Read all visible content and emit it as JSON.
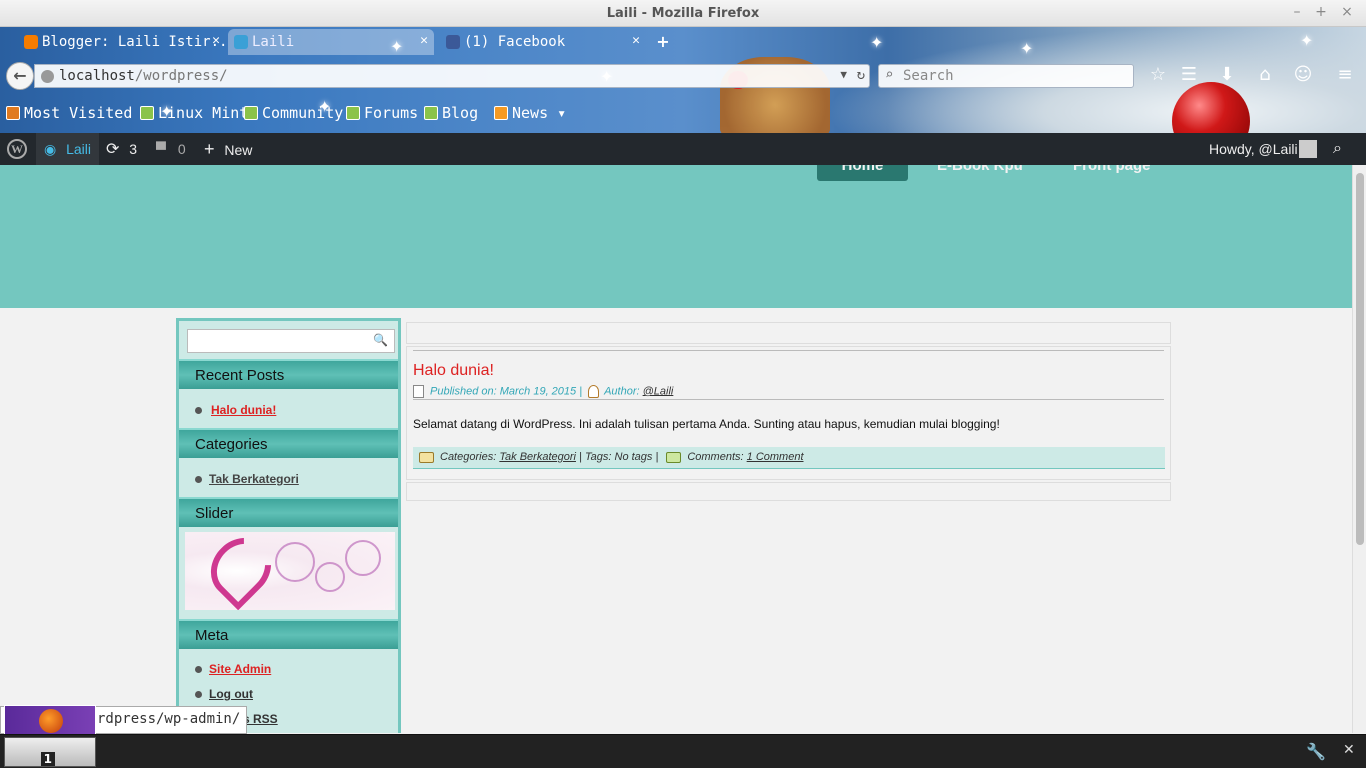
{
  "window": {
    "title": "Laili - Mozilla Firefox",
    "minimize": "–",
    "maximize": "+",
    "close": "×"
  },
  "tabs": [
    {
      "label": "Blogger: Laili Istir...",
      "favicon_color": "#f57c00"
    },
    {
      "label": "Laili",
      "favicon_color": "#3aa0d6"
    },
    {
      "label": "(1) Facebook",
      "favicon_color": "#3b5998"
    }
  ],
  "newtab": "+",
  "nav": {
    "url_host": "localhost",
    "url_path": "/wordpress/",
    "search_placeholder": "Search"
  },
  "bookmarks": [
    {
      "label": "Most Visited ▾"
    },
    {
      "label": "Linux Mint"
    },
    {
      "label": "Community"
    },
    {
      "label": "Forums"
    },
    {
      "label": "Blog"
    },
    {
      "label": "News ▾"
    }
  ],
  "adminbar": {
    "site": "Laili",
    "updates": "3",
    "comments": "0",
    "new": "New",
    "howdy": "Howdy, @Laili"
  },
  "site_nav": {
    "home": "Home",
    "item2": "E-Book Kpu",
    "item3": "Front page"
  },
  "sidebar": {
    "recent_title": "Recent Posts",
    "recent_items": [
      "Halo dunia!"
    ],
    "categories_title": "Categories",
    "category_items": [
      "Tak Berkategori"
    ],
    "slider_title": "Slider",
    "meta_title": "Meta",
    "meta_items": [
      "Site Admin",
      "Log out",
      "Entries RSS"
    ]
  },
  "post": {
    "title": "Halo dunia!",
    "published": "Published on: March 19, 2015 |",
    "author_label": "Author:",
    "author": "@Laili",
    "body": "Selamat datang di WordPress. Ini adalah tulisan pertama Anda. Sunting atau hapus, kemudian mulai blogging!",
    "categories_label": "Categories:",
    "category": "Tak Berkategori",
    "tags": "|   Tags: No tags |",
    "comments_label": "Comments:",
    "comments": "1 Comment"
  },
  "status": {
    "link": "rdpress/wp-admin/",
    "task_count": "1"
  }
}
